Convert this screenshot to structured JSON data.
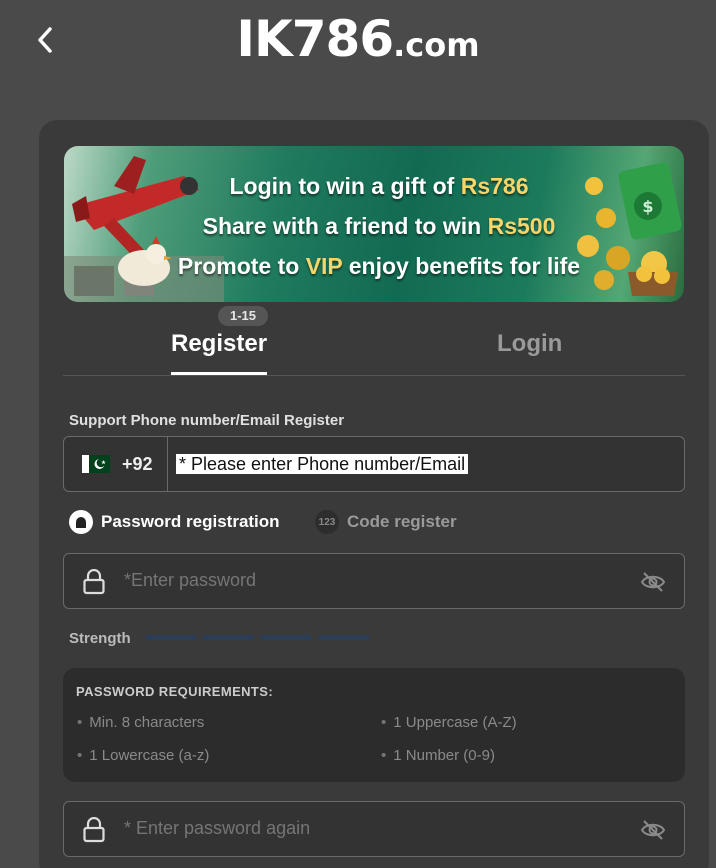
{
  "header": {
    "logo_main": "IK786",
    "logo_suffix": ".com"
  },
  "banner": {
    "line1_text": "Login to win a gift of ",
    "line1_amount": "Rs786",
    "line2_text": "Share with a friend to win ",
    "line2_amount": "Rs500",
    "line3_prefix": "Promote to ",
    "line3_vip": "VIP",
    "line3_suffix": " enjoy benefits for life"
  },
  "tabs": {
    "badge": "1-15",
    "register": "Register",
    "login": "Login",
    "active": "Register"
  },
  "form": {
    "phone_label": "Support Phone number/Email Register",
    "country_code": "+92",
    "phone_value": "* Please enter Phone number/Email",
    "mode_password": "Password registration",
    "mode_code_icon": "123",
    "mode_code": "Code register",
    "password_placeholder": "*Enter password",
    "strength_label": "Strength",
    "confirm_placeholder": "* Enter password again"
  },
  "requirements": {
    "title": "PASSWORD REQUIREMENTS:",
    "items": [
      "Min. 8 characters",
      "1 Uppercase (A-Z)",
      "1 Lowercase (a-z)",
      "1 Number (0-9)"
    ]
  },
  "colors": {
    "background": "#4a4a4a",
    "panel": "#3a3a3a",
    "highlight": "#f6d66b",
    "strength_bar": "#2c3e55"
  },
  "icons": {
    "back": "chevron-left-icon",
    "flag": "pakistan-flag-icon",
    "lock": "lock-icon",
    "eye": "eye-off-icon"
  }
}
